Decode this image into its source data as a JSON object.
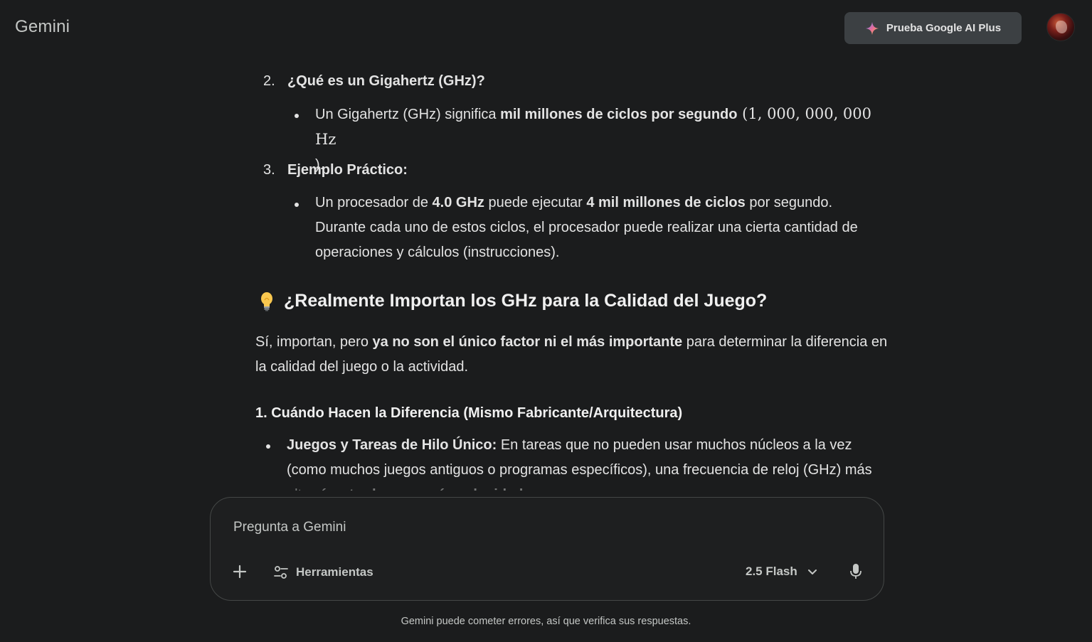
{
  "header": {
    "app_title": "Gemini",
    "upgrade_label": "Prueba Google AI Plus"
  },
  "response": {
    "item2_number": "2.",
    "item2_title": "¿Qué es un Gigahertz (GHz)?",
    "item2_bullet_pre": "Un Gigahertz (GHz) significa ",
    "item2_bullet_bold": "mil millones de ciclos por segundo",
    "item2_bullet_math": " (1, 000, 000, 000 Hz",
    "item2_bullet_tail": ").",
    "item3_number": "3.",
    "item3_title": "Ejemplo Práctico:",
    "item3_pre": "Un procesador de ",
    "item3_bold1": "4.0 GHz",
    "item3_mid": " puede ejecutar ",
    "item3_bold2": "4 mil millones de ciclos",
    "item3_post": " por segundo. Durante cada uno de estos ciclos, el procesador puede realizar una cierta cantidad de operaciones y cálculos (instrucciones).",
    "section_heading": "¿Realmente Importan los GHz para la Calidad del Juego?",
    "para_pre": "Sí, importan, pero ",
    "para_bold": "ya no son el único factor ni el más importante",
    "para_post": " para determinar la diferencia en la calidad del juego o la actividad.",
    "subheading": "1. Cuándo Hacen la Diferencia (Mismo Fabricante/Arquitectura)",
    "bullet_bold": "Juegos y Tareas de Hilo Único:",
    "bullet_text": " En tareas que no pueden usar muchos núcleos a la vez (como muchos juegos antiguos o programas específicos), una frecuencia de reloj (GHz) más",
    "bullet_faded_pre": "alta ",
    "bullet_faded_bold": "sí se traduce en más velocidad"
  },
  "composer": {
    "placeholder": "Pregunta a Gemini",
    "tools_label": "Herramientas",
    "model_label": "2.5 Flash"
  },
  "footer": {
    "disclaimer": "Gemini puede cometer errores, así que verifica sus respuestas."
  },
  "icons": {
    "spark": "spark-icon",
    "bulb": "lightbulb-icon",
    "plus": "plus-icon",
    "tools": "tune-icon",
    "chevron": "chevron-down-icon",
    "mic": "microphone-icon"
  },
  "colors": {
    "background": "#1b1c1d",
    "text": "#e3e3e3",
    "muted": "#c4c7c5",
    "upgrade_bg": "#3c4043",
    "composer_border": "#444746"
  }
}
